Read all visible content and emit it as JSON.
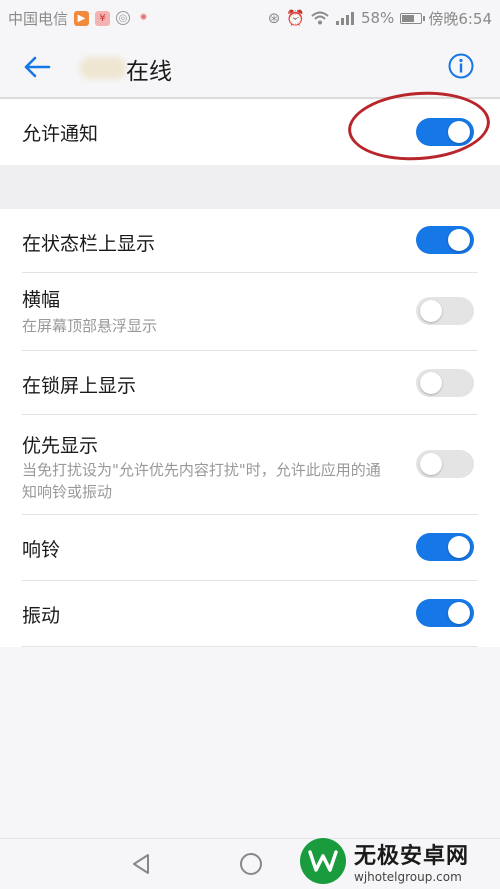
{
  "status_bar": {
    "carrier": "中国电信",
    "battery": "58%",
    "time": "傍晚6:54"
  },
  "header": {
    "title": "在线"
  },
  "main_toggle": {
    "label": "允许通知",
    "state": "on"
  },
  "settings": [
    {
      "label": "在状态栏上显示",
      "sub": "",
      "state": "on"
    },
    {
      "label": "横幅",
      "sub": "在屏幕顶部悬浮显示",
      "state": "off"
    },
    {
      "label": "在锁屏上显示",
      "sub": "",
      "state": "off"
    },
    {
      "label": "优先显示",
      "sub": "当免打扰设为\"允许优先内容打扰\"时，允许此应用的通知响铃或振动",
      "state": "off"
    },
    {
      "label": "响铃",
      "sub": "",
      "state": "on"
    },
    {
      "label": "振动",
      "sub": "",
      "state": "on"
    }
  ],
  "watermark": {
    "title": "无极安卓网",
    "url": "wjhotelgroup.com"
  },
  "colors": {
    "toggle_on": "#1677e6",
    "toggle_off": "#e4e4e4",
    "annotation": "#b8262c"
  }
}
